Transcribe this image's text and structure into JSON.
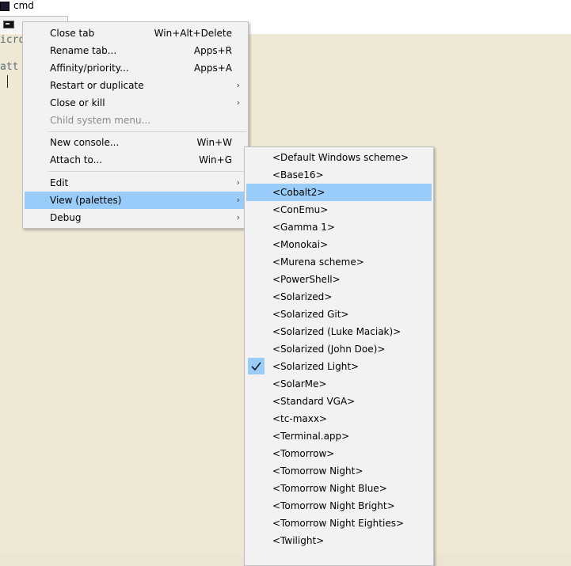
{
  "window": {
    "title": "cmd"
  },
  "console": {
    "line1": "icro",
    "line2": "att"
  },
  "main_menu": {
    "items": [
      {
        "label": "Close tab",
        "shortcut": "Win+Alt+Delete"
      },
      {
        "label": "Rename tab...",
        "shortcut": "Apps+R"
      },
      {
        "label": "Affinity/priority...",
        "shortcut": "Apps+A"
      },
      {
        "label": "Restart or duplicate",
        "shortcut": ""
      },
      {
        "label": "Close or kill",
        "shortcut": ""
      },
      {
        "label": "Child system menu...",
        "shortcut": ""
      },
      {
        "label": "New console...",
        "shortcut": "Win+W"
      },
      {
        "label": "Attach to...",
        "shortcut": "Win+G"
      },
      {
        "label": "Edit",
        "shortcut": ""
      },
      {
        "label": "View (palettes)",
        "shortcut": ""
      },
      {
        "label": "Debug",
        "shortcut": ""
      }
    ]
  },
  "palettes": {
    "items": [
      "<Default Windows scheme>",
      "<Base16>",
      "<Cobalt2>",
      "<ConEmu>",
      "<Gamma 1>",
      "<Monokai>",
      "<Murena scheme>",
      "<PowerShell>",
      "<Solarized>",
      "<Solarized Git>",
      "<Solarized (Luke Maciak)>",
      "<Solarized (John Doe)>",
      "<Solarized Light>",
      "<SolarMe>",
      "<Standard VGA>",
      "<tc-maxx>",
      "<Terminal.app>",
      "<Tomorrow>",
      "<Tomorrow Night>",
      "<Tomorrow Night Blue>",
      "<Tomorrow Night Bright>",
      "<Tomorrow Night Eighties>",
      "<Twilight>"
    ],
    "highlighted": "<Cobalt2>",
    "checked": "<Solarized Light>"
  },
  "colors": {
    "highlight": "#99ccf8",
    "console_bg": "#efe8d5",
    "menu_bg": "#f2f2f2"
  }
}
